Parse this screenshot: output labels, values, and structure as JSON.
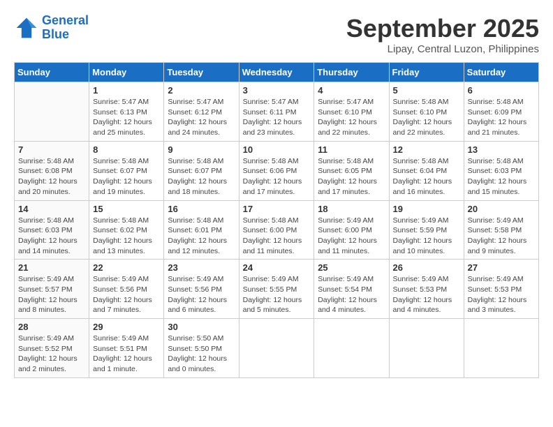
{
  "logo": {
    "line1": "General",
    "line2": "Blue"
  },
  "title": "September 2025",
  "location": "Lipay, Central Luzon, Philippines",
  "weekdays": [
    "Sunday",
    "Monday",
    "Tuesday",
    "Wednesday",
    "Thursday",
    "Friday",
    "Saturday"
  ],
  "weeks": [
    [
      {
        "day": "",
        "info": ""
      },
      {
        "day": "1",
        "info": "Sunrise: 5:47 AM\nSunset: 6:13 PM\nDaylight: 12 hours\nand 25 minutes."
      },
      {
        "day": "2",
        "info": "Sunrise: 5:47 AM\nSunset: 6:12 PM\nDaylight: 12 hours\nand 24 minutes."
      },
      {
        "day": "3",
        "info": "Sunrise: 5:47 AM\nSunset: 6:11 PM\nDaylight: 12 hours\nand 23 minutes."
      },
      {
        "day": "4",
        "info": "Sunrise: 5:47 AM\nSunset: 6:10 PM\nDaylight: 12 hours\nand 22 minutes."
      },
      {
        "day": "5",
        "info": "Sunrise: 5:48 AM\nSunset: 6:10 PM\nDaylight: 12 hours\nand 22 minutes."
      },
      {
        "day": "6",
        "info": "Sunrise: 5:48 AM\nSunset: 6:09 PM\nDaylight: 12 hours\nand 21 minutes."
      }
    ],
    [
      {
        "day": "7",
        "info": "Sunrise: 5:48 AM\nSunset: 6:08 PM\nDaylight: 12 hours\nand 20 minutes."
      },
      {
        "day": "8",
        "info": "Sunrise: 5:48 AM\nSunset: 6:07 PM\nDaylight: 12 hours\nand 19 minutes."
      },
      {
        "day": "9",
        "info": "Sunrise: 5:48 AM\nSunset: 6:07 PM\nDaylight: 12 hours\nand 18 minutes."
      },
      {
        "day": "10",
        "info": "Sunrise: 5:48 AM\nSunset: 6:06 PM\nDaylight: 12 hours\nand 17 minutes."
      },
      {
        "day": "11",
        "info": "Sunrise: 5:48 AM\nSunset: 6:05 PM\nDaylight: 12 hours\nand 17 minutes."
      },
      {
        "day": "12",
        "info": "Sunrise: 5:48 AM\nSunset: 6:04 PM\nDaylight: 12 hours\nand 16 minutes."
      },
      {
        "day": "13",
        "info": "Sunrise: 5:48 AM\nSunset: 6:03 PM\nDaylight: 12 hours\nand 15 minutes."
      }
    ],
    [
      {
        "day": "14",
        "info": "Sunrise: 5:48 AM\nSunset: 6:03 PM\nDaylight: 12 hours\nand 14 minutes."
      },
      {
        "day": "15",
        "info": "Sunrise: 5:48 AM\nSunset: 6:02 PM\nDaylight: 12 hours\nand 13 minutes."
      },
      {
        "day": "16",
        "info": "Sunrise: 5:48 AM\nSunset: 6:01 PM\nDaylight: 12 hours\nand 12 minutes."
      },
      {
        "day": "17",
        "info": "Sunrise: 5:48 AM\nSunset: 6:00 PM\nDaylight: 12 hours\nand 11 minutes."
      },
      {
        "day": "18",
        "info": "Sunrise: 5:49 AM\nSunset: 6:00 PM\nDaylight: 12 hours\nand 11 minutes."
      },
      {
        "day": "19",
        "info": "Sunrise: 5:49 AM\nSunset: 5:59 PM\nDaylight: 12 hours\nand 10 minutes."
      },
      {
        "day": "20",
        "info": "Sunrise: 5:49 AM\nSunset: 5:58 PM\nDaylight: 12 hours\nand 9 minutes."
      }
    ],
    [
      {
        "day": "21",
        "info": "Sunrise: 5:49 AM\nSunset: 5:57 PM\nDaylight: 12 hours\nand 8 minutes."
      },
      {
        "day": "22",
        "info": "Sunrise: 5:49 AM\nSunset: 5:56 PM\nDaylight: 12 hours\nand 7 minutes."
      },
      {
        "day": "23",
        "info": "Sunrise: 5:49 AM\nSunset: 5:56 PM\nDaylight: 12 hours\nand 6 minutes."
      },
      {
        "day": "24",
        "info": "Sunrise: 5:49 AM\nSunset: 5:55 PM\nDaylight: 12 hours\nand 5 minutes."
      },
      {
        "day": "25",
        "info": "Sunrise: 5:49 AM\nSunset: 5:54 PM\nDaylight: 12 hours\nand 4 minutes."
      },
      {
        "day": "26",
        "info": "Sunrise: 5:49 AM\nSunset: 5:53 PM\nDaylight: 12 hours\nand 4 minutes."
      },
      {
        "day": "27",
        "info": "Sunrise: 5:49 AM\nSunset: 5:53 PM\nDaylight: 12 hours\nand 3 minutes."
      }
    ],
    [
      {
        "day": "28",
        "info": "Sunrise: 5:49 AM\nSunset: 5:52 PM\nDaylight: 12 hours\nand 2 minutes."
      },
      {
        "day": "29",
        "info": "Sunrise: 5:49 AM\nSunset: 5:51 PM\nDaylight: 12 hours\nand 1 minute."
      },
      {
        "day": "30",
        "info": "Sunrise: 5:50 AM\nSunset: 5:50 PM\nDaylight: 12 hours\nand 0 minutes."
      },
      {
        "day": "",
        "info": ""
      },
      {
        "day": "",
        "info": ""
      },
      {
        "day": "",
        "info": ""
      },
      {
        "day": "",
        "info": ""
      }
    ]
  ]
}
